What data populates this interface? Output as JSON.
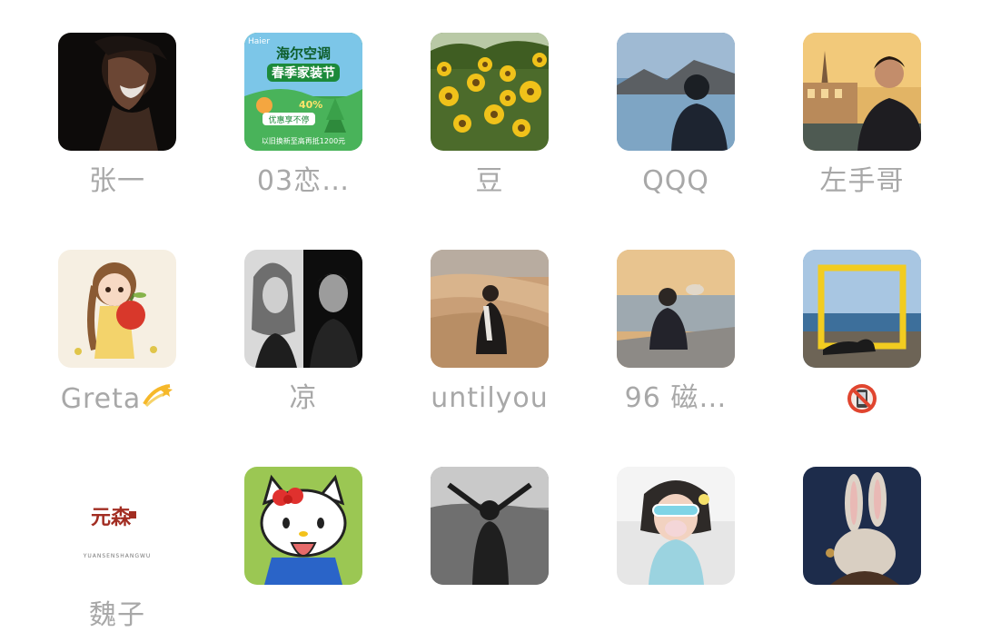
{
  "contacts": [
    {
      "name": "张一",
      "avatar_icon": "smiling-man-dark-avatar"
    },
    {
      "name": "03恋…",
      "avatar_icon": "haier-ad-avatar",
      "avatar_text": {
        "brand": "Haier",
        "line1": "海尔空调",
        "line2": "春季家装节",
        "line3": "优惠享不停",
        "line4": "以旧换新至高再抵1200元",
        "badge": "40%"
      }
    },
    {
      "name": "豆",
      "avatar_icon": "sunflowers-avatar"
    },
    {
      "name": "QQQ",
      "avatar_icon": "man-by-lake-avatar"
    },
    {
      "name": "左手哥",
      "avatar_icon": "man-in-city-avatar"
    },
    {
      "name": "Greta",
      "name_emoji": "dizzy-icon",
      "avatar_icon": "girl-with-apple-avatar"
    },
    {
      "name": "凉",
      "avatar_icon": "bw-couple-avatar"
    },
    {
      "name": "untilyou",
      "avatar_icon": "woman-in-desert-avatar"
    },
    {
      "name": "96  磁…",
      "avatar_icon": "sitting-man-sunset-avatar"
    },
    {
      "name": "",
      "name_emoji": "no-mobile-phones-icon",
      "avatar_icon": "yellow-frame-beach-avatar"
    },
    {
      "name": "魏子",
      "avatar_icon": "yuansen-logo-avatar",
      "avatar_text": {
        "logo_cn": "元森",
        "logo_en": "YUANSENSHANGWU"
      }
    },
    {
      "name": "",
      "avatar_icon": "hello-kitty-avatar"
    },
    {
      "name": "",
      "avatar_icon": "woman-arms-raised-avatar"
    },
    {
      "name": "",
      "avatar_icon": "girl-sunglasses-avatar"
    },
    {
      "name": "",
      "avatar_icon": "bunny-ears-avatar"
    }
  ],
  "colors": {
    "name_text": "#a8a8a8",
    "background": "#ffffff"
  }
}
